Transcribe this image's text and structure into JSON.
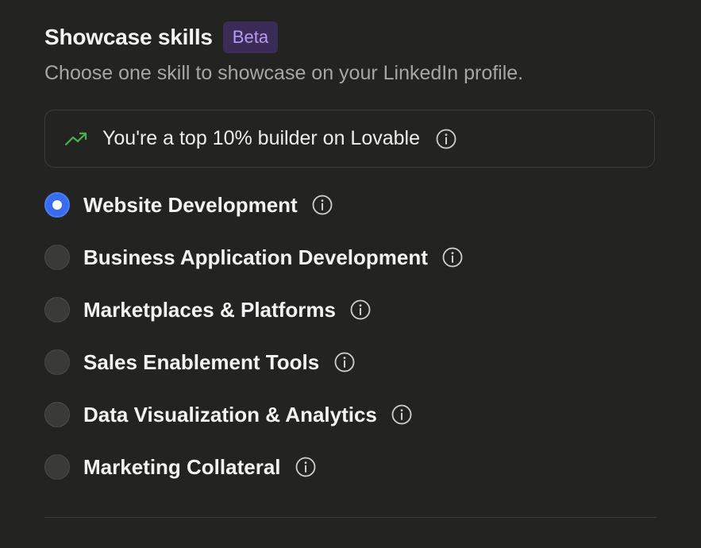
{
  "header": {
    "title": "Showcase skills",
    "badge": "Beta"
  },
  "subtitle": "Choose one skill to showcase on your LinkedIn profile.",
  "banner": {
    "icon": "trending-up-icon",
    "text": "You're a top 10% builder on Lovable",
    "info_icon": "info-icon"
  },
  "skills": {
    "selected": "Website Development",
    "options": [
      {
        "label": "Website Development",
        "checked": true
      },
      {
        "label": "Business Application Development",
        "checked": false
      },
      {
        "label": "Marketplaces & Platforms",
        "checked": false
      },
      {
        "label": "Sales Enablement Tools",
        "checked": false
      },
      {
        "label": "Data Visualization & Analytics",
        "checked": false
      },
      {
        "label": "Marketing Collateral",
        "checked": false
      }
    ]
  },
  "colors": {
    "background": "#232322",
    "accent": "#3a6cf0",
    "badge_bg": "#3a2b57",
    "badge_text": "#b69af3",
    "trend_green": "#4caf50"
  }
}
